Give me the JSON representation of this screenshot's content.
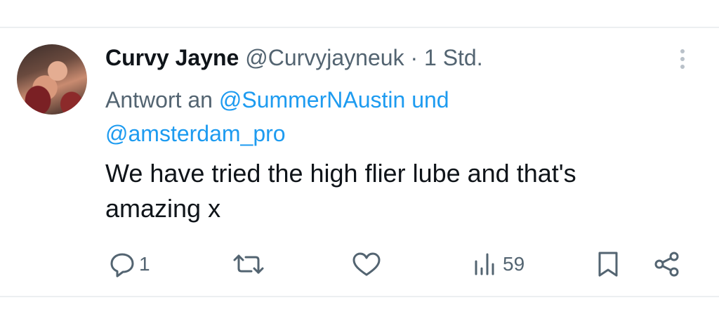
{
  "tweet": {
    "author_name": "Curvy Jayne",
    "handle": "@Curvyjayneuk",
    "separator": "·",
    "time": "1 Std.",
    "reply_prefix": "Antwort an",
    "mention_1": "@SummerNAustin",
    "reply_joiner": "und",
    "mention_2": "@amsterdam_pro",
    "text_line1": "We have tried the high flier lube and that's",
    "text_line2": "amazing x"
  },
  "actions": {
    "reply_count": "1",
    "retweet_count": "",
    "like_count": "",
    "views_count": "59"
  },
  "icons": [
    "reply-icon",
    "retweet-icon",
    "like-icon",
    "views-icon",
    "bookmark-icon",
    "share-icon",
    "more-icon"
  ],
  "colors": {
    "text": "#0f1419",
    "muted": "#536471",
    "link": "#1d9bf0",
    "divider": "#eceff1"
  }
}
